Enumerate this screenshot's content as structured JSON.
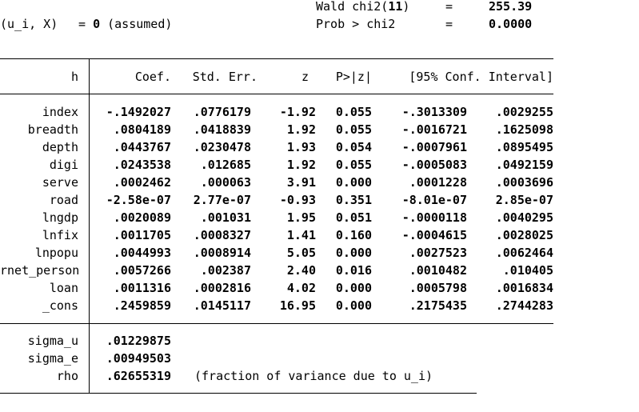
{
  "header": {
    "left_label": "(u_i, X)",
    "left_eq": "= ",
    "left_value": "0",
    "left_note": " (assumed)",
    "stats": [
      {
        "label": "Wald chi2(",
        "arg": "11",
        "close": ")",
        "eq": "=",
        "value": "255.39"
      },
      {
        "label": "Prob > chi2",
        "arg": "",
        "close": "",
        "eq": "=",
        "value": "0.0000"
      }
    ]
  },
  "columns": [
    "h",
    "Coef.",
    "Std. Err.",
    "z",
    "P>|z|",
    "[95% Conf. Interval]"
  ],
  "rows": [
    {
      "name": "index",
      "coef": "-.1492027",
      "se": ".0776179",
      "z": "-1.92",
      "p": "0.055",
      "lo": "-.3013309",
      "hi": ".0029255"
    },
    {
      "name": "breadth",
      "coef": ".0804189",
      "se": ".0418839",
      "z": "1.92",
      "p": "0.055",
      "lo": "-.0016721",
      "hi": ".1625098"
    },
    {
      "name": "depth",
      "coef": ".0443767",
      "se": ".0230478",
      "z": "1.93",
      "p": "0.054",
      "lo": "-.0007961",
      "hi": ".0895495"
    },
    {
      "name": "digi",
      "coef": ".0243538",
      "se": ".012685",
      "z": "1.92",
      "p": "0.055",
      "lo": "-.0005083",
      "hi": ".0492159"
    },
    {
      "name": "serve",
      "coef": ".0002462",
      "se": ".000063",
      "z": "3.91",
      "p": "0.000",
      "lo": ".0001228",
      "hi": ".0003696"
    },
    {
      "name": "road",
      "coef": "-2.58e-07",
      "se": "2.77e-07",
      "z": "-0.93",
      "p": "0.351",
      "lo": "-8.01e-07",
      "hi": "2.85e-07"
    },
    {
      "name": "lngdp",
      "coef": ".0020089",
      "se": ".001031",
      "z": "1.95",
      "p": "0.051",
      "lo": "-.0000118",
      "hi": ".0040295"
    },
    {
      "name": "lnfix",
      "coef": ".0011705",
      "se": ".0008327",
      "z": "1.41",
      "p": "0.160",
      "lo": "-.0004615",
      "hi": ".0028025"
    },
    {
      "name": "lnpopu",
      "coef": ".0044993",
      "se": ".0008914",
      "z": "5.05",
      "p": "0.000",
      "lo": ".0027523",
      "hi": ".0062464"
    },
    {
      "name": "rnet_person",
      "coef": ".0057266",
      "se": ".002387",
      "z": "2.40",
      "p": "0.016",
      "lo": ".0010482",
      "hi": ".010405"
    },
    {
      "name": "loan",
      "coef": ".0011316",
      "se": ".0002816",
      "z": "4.02",
      "p": "0.000",
      "lo": ".0005798",
      "hi": ".0016834"
    },
    {
      "name": "_cons",
      "coef": ".2459859",
      "se": ".0145117",
      "z": "16.95",
      "p": "0.000",
      "lo": ".2175435",
      "hi": ".2744283"
    }
  ],
  "sigma": [
    {
      "name": "sigma_u",
      "value": ".01229875",
      "note": ""
    },
    {
      "name": "sigma_e",
      "value": ".00949503",
      "note": ""
    },
    {
      "name": "rho",
      "value": ".62655319",
      "note": "(fraction of variance due to u_i)"
    }
  ]
}
